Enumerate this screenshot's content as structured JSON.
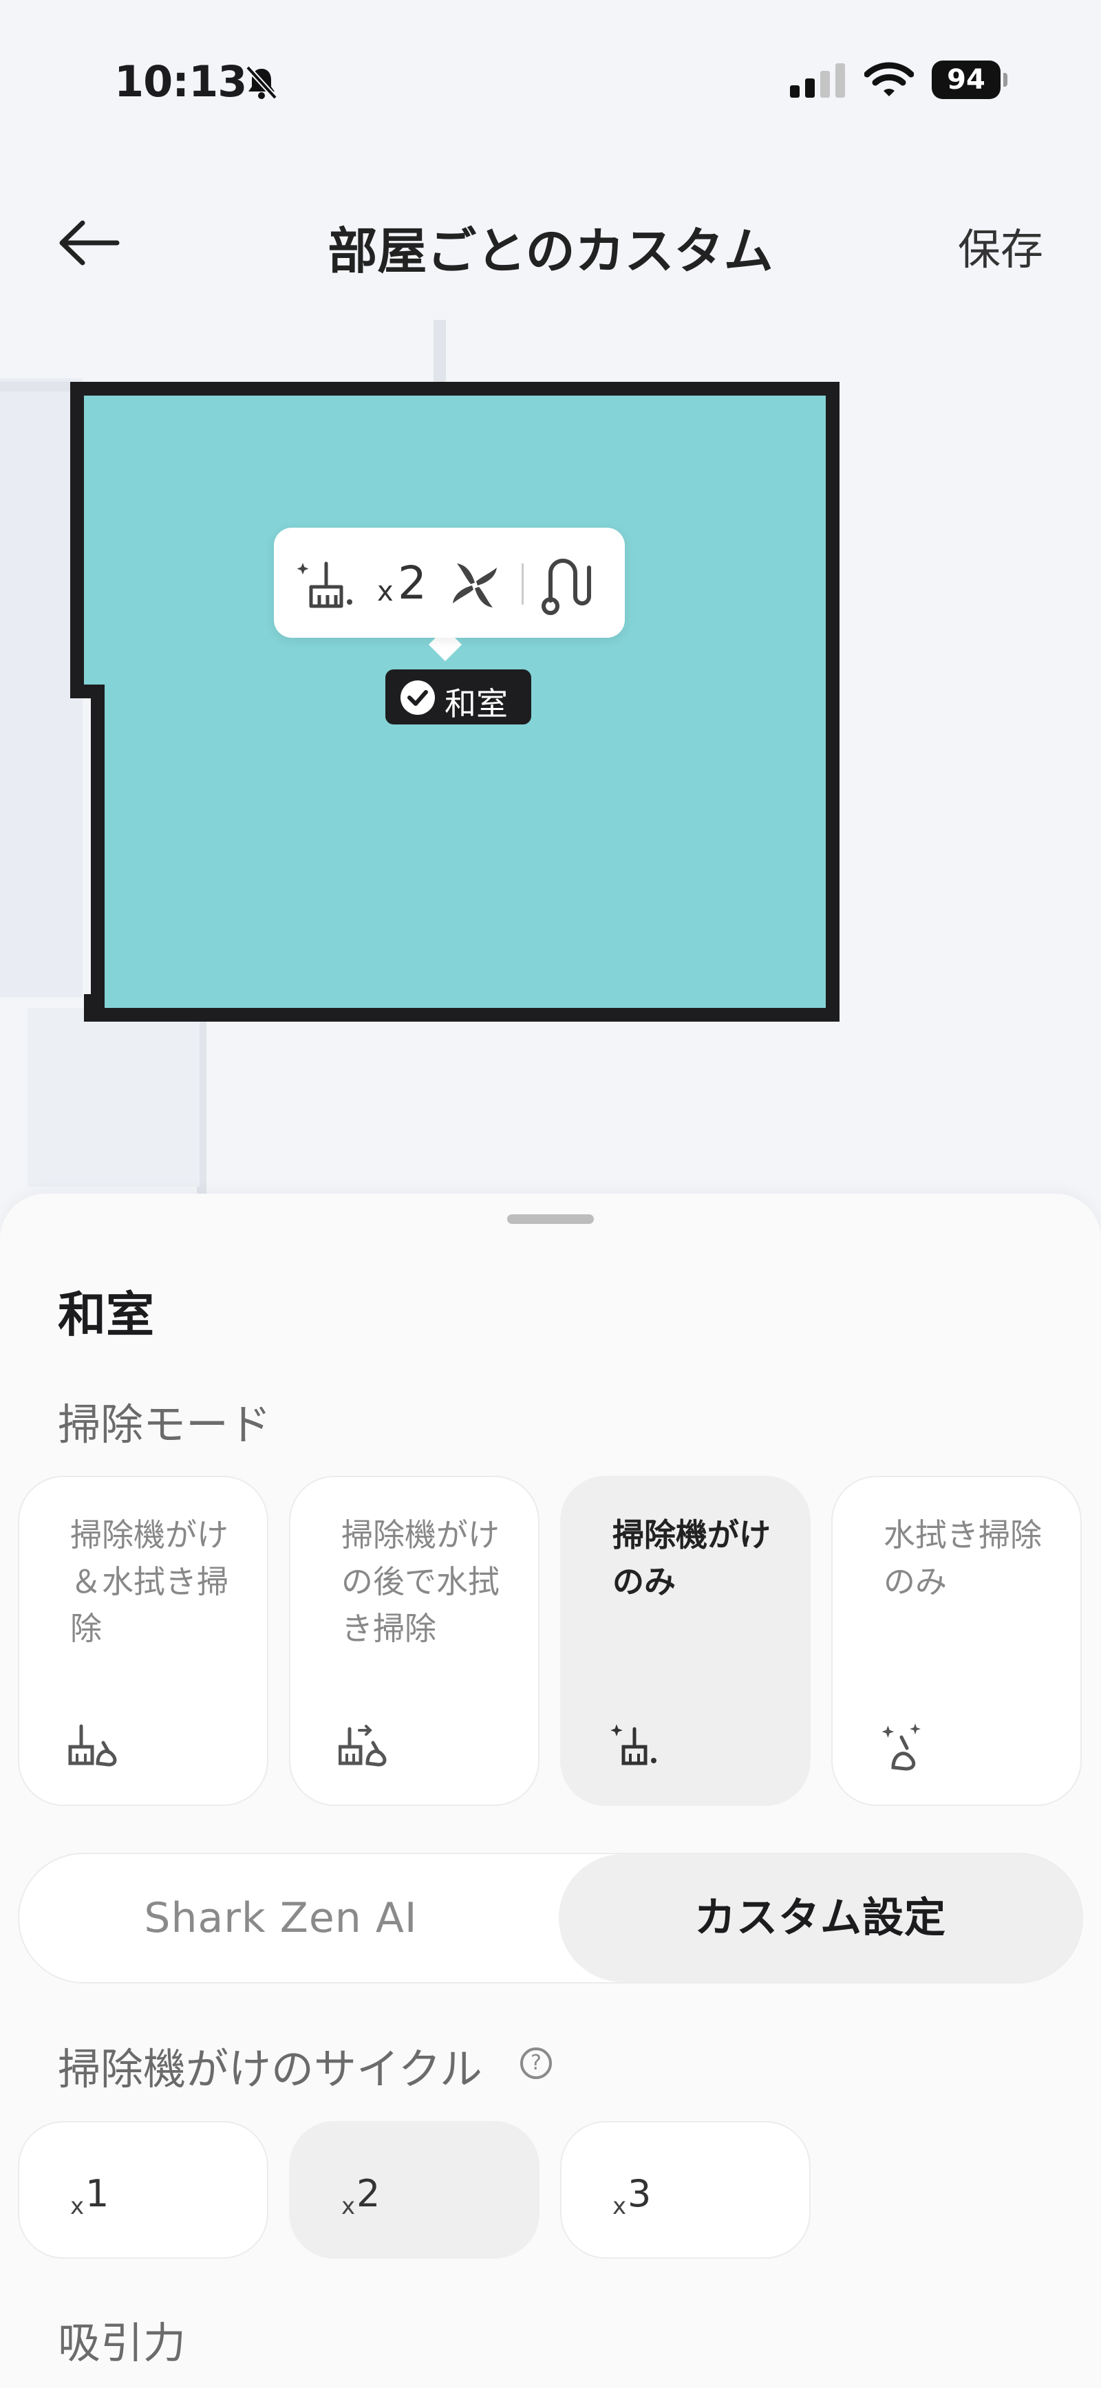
{
  "status_bar": {
    "time": "10:13",
    "battery": "94"
  },
  "header": {
    "title": "部屋ごとのカスタム",
    "save_label": "保存"
  },
  "map": {
    "popup": {
      "times_symbol": "x",
      "cycle_count": "2"
    },
    "room_badge": "和室",
    "room_color": "#84d3d6"
  },
  "sheet": {
    "room_name": "和室",
    "cleaning_mode_label": "掃除モード",
    "modes": [
      {
        "label": "掃除機がけ＆水拭き掃除",
        "icon": "vacuum-mop-icon",
        "selected": false
      },
      {
        "label": "掃除機がけの後で水拭き掃除",
        "icon": "vacuum-then-mop-icon",
        "selected": false
      },
      {
        "label": "掃除機がけのみ",
        "icon": "vacuum-only-icon",
        "selected": true
      },
      {
        "label": "水拭き掃除のみ",
        "icon": "mop-only-icon",
        "selected": false
      }
    ],
    "segment": {
      "left": "Shark Zen AI",
      "right": "カスタム設定",
      "selected": "right"
    },
    "cycle_label": "掃除機がけのサイクル",
    "help_symbol": "?",
    "cycles": [
      {
        "times_symbol": "x",
        "value": "1",
        "selected": false
      },
      {
        "times_symbol": "x",
        "value": "2",
        "selected": true
      },
      {
        "times_symbol": "x",
        "value": "3",
        "selected": false
      }
    ],
    "suction_label": "吸引力"
  },
  "colors": {
    "accent_room": "#84d3d6",
    "selected_bg": "#efefef"
  }
}
